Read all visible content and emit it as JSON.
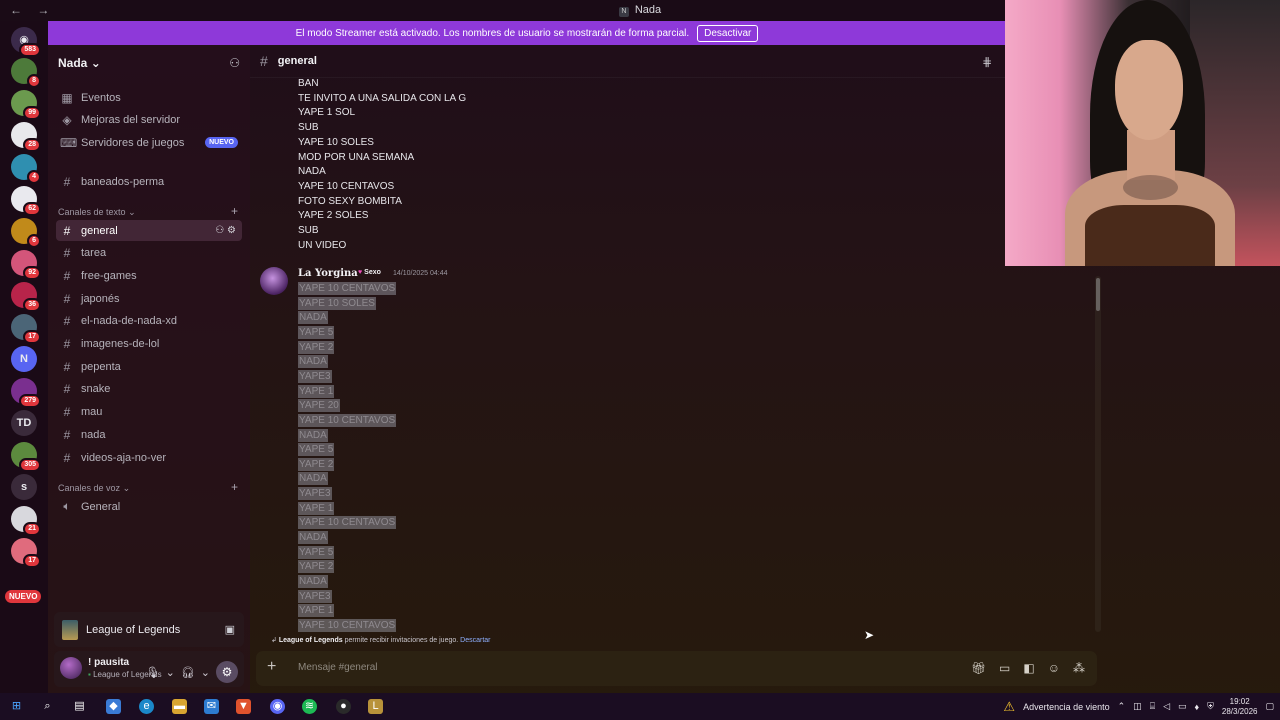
{
  "titlebar": {
    "title": "Nada",
    "logo": "N",
    "nav": "← →"
  },
  "banner": {
    "text": "El modo Streamer está activado. Los nombres de usuario se mostrarán de forma parcial.",
    "button": "Desactivar"
  },
  "rail": {
    "top_badge": "583",
    "servers": [
      {
        "badge": "8",
        "color": "#4d7a3a"
      },
      {
        "badge": "99",
        "color": "#6b9a4e"
      },
      {
        "badge": "28",
        "color": "#e8e8ec"
      },
      {
        "badge": "4",
        "color": "#2f8fb0"
      },
      {
        "badge": "62",
        "color": "#e9e9ee"
      },
      {
        "badge": "6",
        "color": "#c18a1a"
      },
      {
        "badge": "92",
        "color": "#d3557a"
      },
      {
        "badge": "36",
        "color": "#b8244a"
      },
      {
        "badge": "17",
        "color": "#4b6577"
      },
      {
        "badge": "",
        "color": "#5865f2",
        "text": "N"
      },
      {
        "badge": "279",
        "color": "#7a2f8f"
      },
      {
        "badge": "",
        "color": "#3a2a3a",
        "text": "TD"
      },
      {
        "badge": "305",
        "color": "#5c8a3e"
      },
      {
        "badge": "",
        "color": "#3a2a3a",
        "text": "s"
      },
      {
        "badge": "21",
        "color": "#d8d8dd"
      },
      {
        "badge": "17",
        "color": "#e06b7d"
      }
    ],
    "new_label": "NUEVO"
  },
  "sidebar": {
    "guild_name": "Nada",
    "items": [
      {
        "icon": "calendar-icon",
        "glyph": "▦",
        "label": "Eventos"
      },
      {
        "icon": "boost-icon",
        "glyph": "◈",
        "label": "Mejoras del servidor"
      },
      {
        "icon": "gamepad-icon",
        "glyph": "⌨",
        "label": "Servidores de juegos",
        "badge": "NUEVO"
      }
    ],
    "pinned_channel": "baneados-perma",
    "text_category": "Canales de texto",
    "text_channels": [
      "general",
      "tarea",
      "free-games",
      "japonés",
      "el-nada-de-nada-xd",
      "imagenes-de-lol",
      "pepenta",
      "snake",
      "mau",
      "nada",
      "videos-aja-no-ver"
    ],
    "voice_category": "Canales de voz",
    "voice_channels": [
      "General"
    ],
    "activity": "League of Legends",
    "user": {
      "name": "! pausita",
      "status": "League of Legends"
    }
  },
  "chat": {
    "channel": "general",
    "previous_lines": [
      "BAN",
      "TE INVITO A UNA SALIDA CON LA G",
      "YAPE 1 SOL",
      "SUB",
      "YAPE 10 SOLES",
      "MOD POR UNA SEMANA",
      "NADA",
      "YAPE 10 CENTAVOS",
      "FOTO SEXY BOMBITA",
      "YAPE 2 SOLES",
      "SUB",
      "UN VIDEO"
    ],
    "message": {
      "author": "La Yorgina",
      "tag": "Sexo",
      "time": "14/10/2025 04:44",
      "lines": [
        "YAPE 10 CENTAVOS",
        "YAPE 10 SOLES",
        "NADA",
        "YAPE 5",
        "YAPE 2",
        "NADA",
        "YAPE3",
        "YAPE 1",
        "YAPE 20",
        "YAPE 10 CENTAVOS",
        "NADA",
        "YAPE 5",
        "YAPE 2",
        "NADA",
        "YAPE3",
        "YAPE 1",
        "YAPE 10 CENTAVOS",
        "NADA",
        "YAPE 5",
        "YAPE 2",
        "NADA",
        "YAPE3",
        "YAPE 1",
        "YAPE 10 CENTAVOS"
      ]
    },
    "invite_note": {
      "game": "League of Legends",
      "text": "permite recibir invitaciones de juego.",
      "dismiss": "Descartar"
    },
    "composer_placeholder": "Mensaje #general"
  },
  "taskbar": {
    "weather": "Advertencia de viento",
    "time": "19:02",
    "date": "28/3/2026"
  }
}
